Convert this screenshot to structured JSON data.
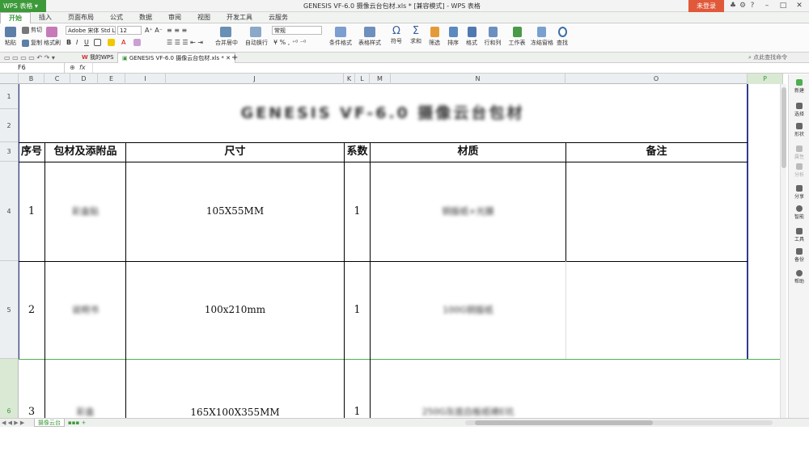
{
  "app": {
    "menu_button": "WPS 表格 ▾",
    "window_title": "GENESIS VF-6.0 摄像云台包材.xls * [兼容模式] - WPS 表格",
    "login_button": "未登录"
  },
  "ribbon_tabs": [
    "开始",
    "插入",
    "页面布局",
    "公式",
    "数据",
    "审阅",
    "视图",
    "开发工具",
    "云服务"
  ],
  "ribbon": {
    "paste": "粘贴",
    "cut": "剪切",
    "copy": "复制",
    "format_painter": "格式刷",
    "font_name": "Adobe 宋体 Std L",
    "font_size": "12",
    "number_format": "常规",
    "merge_center": "合并居中",
    "wrap_text": "自动换行",
    "percent": "%",
    "thousands": ",",
    "cond_format": "条件格式",
    "table_style": "表格样式",
    "symbol": "符号",
    "sum": "求和",
    "filter": "筛选",
    "sort": "排序",
    "format": "格式",
    "rows_cols": "行和列",
    "worksheet": "工作表",
    "freeze": "冻结窗格",
    "find": "查找"
  },
  "doc_tabs": {
    "home": "我的WPS",
    "file": "GENESIS VF-6.0 摄像云台包材.xls *",
    "add": "+",
    "search_hint": "点此查找命令"
  },
  "formula_bar": {
    "cell_ref": "F6",
    "fx": "fx"
  },
  "col_headers": [
    "B",
    "C",
    "D",
    "E",
    "I",
    "J",
    "K",
    "L",
    "M",
    "N",
    "O",
    "P"
  ],
  "row_headers": [
    "1",
    "2",
    "3",
    "4",
    "5",
    "6"
  ],
  "sheet": {
    "title": "GENESIS VF-6.0 摄像云台包材",
    "headers": {
      "no": "序号",
      "material_pkg": "包材及添附品",
      "size": "尺寸",
      "factor": "系数",
      "material": "材质",
      "remark": "备注"
    },
    "rows": [
      {
        "no": "1",
        "item": "彩盒贴",
        "size": "105X55MM",
        "factor": "1",
        "material": "铜版纸+光膜"
      },
      {
        "no": "2",
        "item": "说明书",
        "size": "100x210mm",
        "factor": "1",
        "material": "100G铜版纸"
      },
      {
        "no": "3",
        "item": "彩盒",
        "size": "165X100X355MM",
        "factor": "1",
        "material": "250G灰底白板纸裱E坑"
      }
    ]
  },
  "right_sidebar": [
    "新建",
    "选择",
    "形状",
    "属性",
    "分析",
    "分享",
    "智能",
    "工具",
    "备份",
    "帮助"
  ],
  "status": {
    "sheet_tab": "摄像云台"
  },
  "colors": {
    "wps_green": "#3d9a3a",
    "login_red": "#e0593a",
    "selection_blue": "#2f3c8f"
  }
}
